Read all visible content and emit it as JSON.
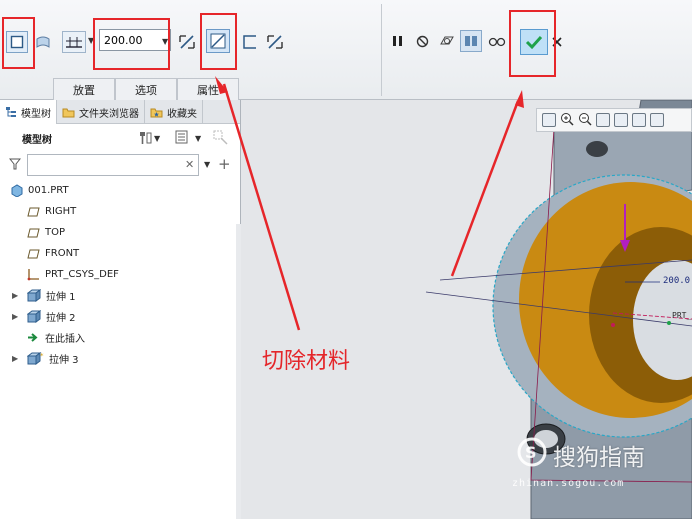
{
  "ribbon": {
    "depth_value": "200.00",
    "tabs": [
      {
        "label": "放置"
      },
      {
        "label": "选项"
      },
      {
        "label": "属性"
      }
    ]
  },
  "sidebar": {
    "tabs": [
      {
        "label": "模型树",
        "icon": "model-tree-icon"
      },
      {
        "label": "文件夹浏览器",
        "icon": "folder-icon"
      },
      {
        "label": "收藏夹",
        "icon": "favorites-icon"
      }
    ],
    "tree_title": "模型树",
    "filter_placeholder": "",
    "items": [
      {
        "label": "001.PRT",
        "icon": "part-icon"
      },
      {
        "label": "RIGHT",
        "icon": "datum-plane-icon"
      },
      {
        "label": "TOP",
        "icon": "datum-plane-icon"
      },
      {
        "label": "FRONT",
        "icon": "datum-plane-icon"
      },
      {
        "label": "PRT_CSYS_DEF",
        "icon": "csys-icon"
      },
      {
        "label": "拉伸 1",
        "icon": "extrude-icon"
      },
      {
        "label": "拉伸 2",
        "icon": "extrude-icon"
      },
      {
        "label": "在此插入",
        "icon": "insert-arrow-icon"
      },
      {
        "label": "拉伸 3",
        "icon": "extrude-icon"
      }
    ]
  },
  "viewport": {
    "dimension_label": "200.0",
    "csys_label": "PRT_"
  },
  "annotation": {
    "text": "切除材料"
  },
  "watermark": {
    "brand": "搜狗指南",
    "url": "zhinan.sogou.com"
  },
  "colors": {
    "accent_red": "#e6262a",
    "confirm_green": "#1fa24a",
    "hole_orange": "#c98a12",
    "part_gray": "#8f9ba8"
  }
}
